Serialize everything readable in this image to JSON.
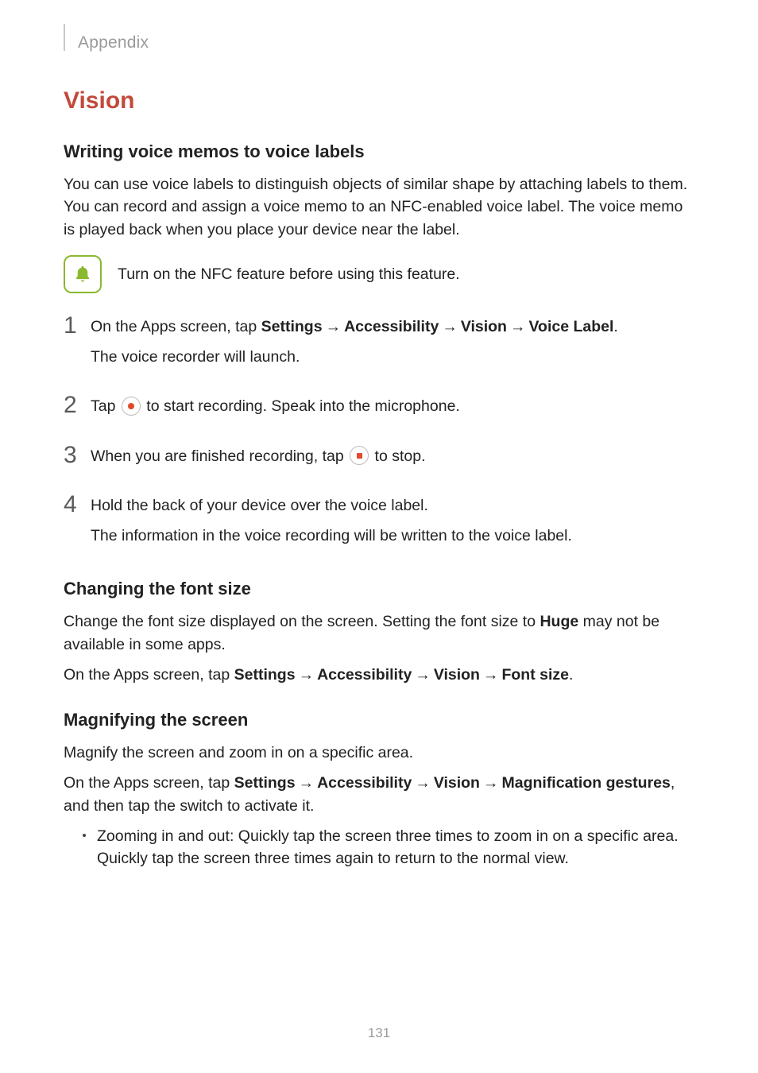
{
  "header": {
    "section": "Appendix"
  },
  "h1": "Vision",
  "sec1": {
    "heading": "Writing voice memos to voice labels",
    "intro": "You can use voice labels to distinguish objects of similar shape by attaching labels to them. You can record and assign a voice memo to an NFC-enabled voice label. The voice memo is played back when you place your device near the label.",
    "note": "Turn on the NFC feature before using this feature.",
    "steps": {
      "n1": "1",
      "s1a_pre": "On the Apps screen, tap ",
      "s1a_b1": "Settings",
      "s1a_b2": "Accessibility",
      "s1a_b3": "Vision",
      "s1a_b4": "Voice Label",
      "s1a_post": ".",
      "s1b": "The voice recorder will launch.",
      "n2": "2",
      "s2_pre": "Tap ",
      "s2_post": " to start recording. Speak into the microphone.",
      "n3": "3",
      "s3_pre": "When you are finished recording, tap ",
      "s3_post": " to stop.",
      "n4": "4",
      "s4a": "Hold the back of your device over the voice label.",
      "s4b": "The information in the voice recording will be written to the voice label."
    }
  },
  "sec2": {
    "heading": "Changing the font size",
    "p1_pre": "Change the font size displayed on the screen. Setting the font size to ",
    "p1_b": "Huge",
    "p1_post": " may not be available in some apps.",
    "p2_pre": "On the Apps screen, tap ",
    "p2_b1": "Settings",
    "p2_b2": "Accessibility",
    "p2_b3": "Vision",
    "p2_b4": "Font size",
    "p2_post": "."
  },
  "sec3": {
    "heading": "Magnifying the screen",
    "p1": "Magnify the screen and zoom in on a specific area.",
    "p2_pre": "On the Apps screen, tap ",
    "p2_b1": "Settings",
    "p2_b2": "Accessibility",
    "p2_b3": "Vision",
    "p2_b4": "Magnification gestures",
    "p2_post": ", and then tap the switch to activate it.",
    "bullet": "Zooming in and out: Quickly tap the screen three times to zoom in on a specific area. Quickly tap the screen three times again to return to the normal view."
  },
  "arrow": "→",
  "pagenum": "131"
}
